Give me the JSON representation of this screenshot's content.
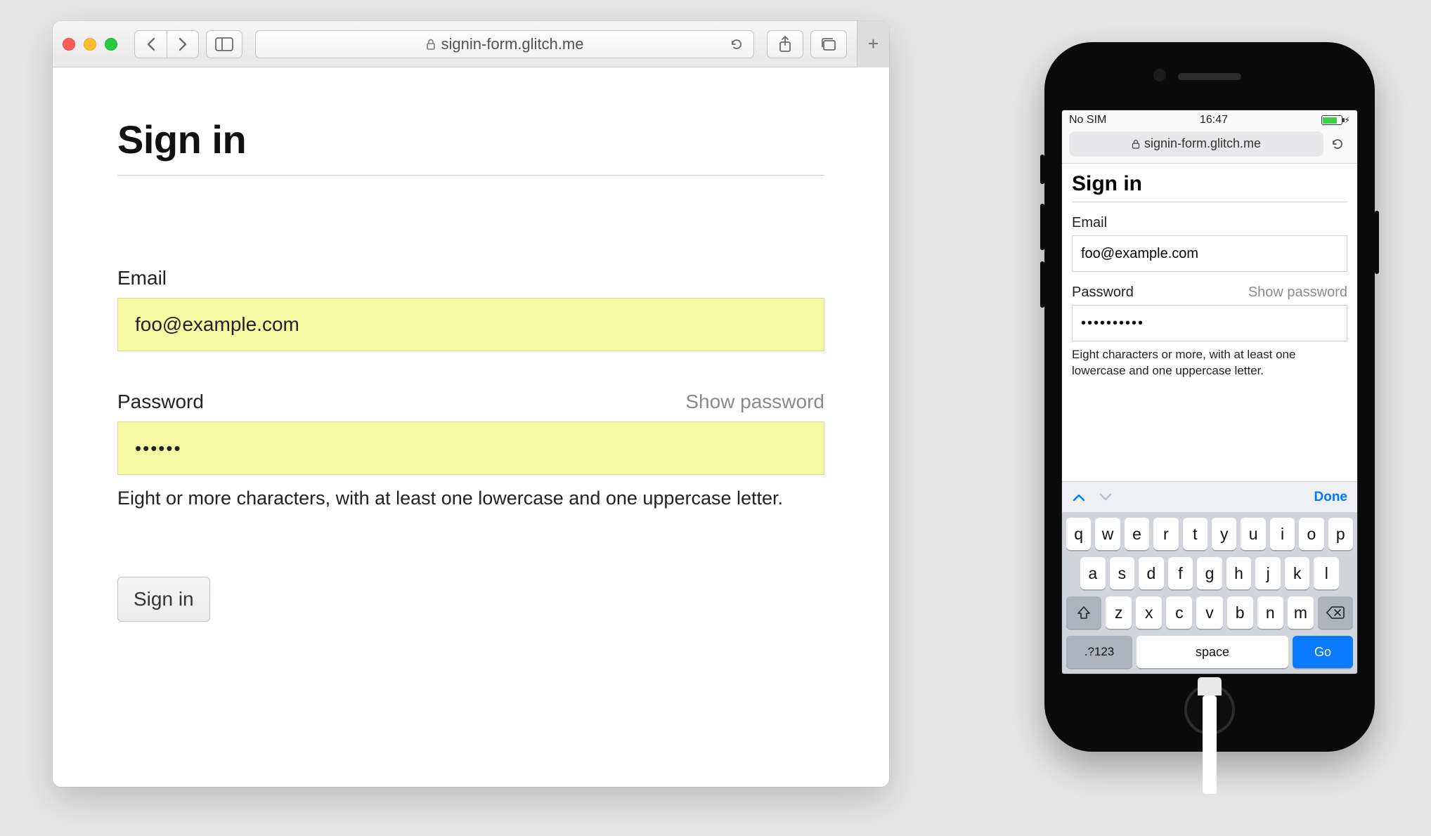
{
  "desktop": {
    "url_host": "signin-form.glitch.me",
    "form": {
      "title": "Sign in",
      "email_label": "Email",
      "email_value": "foo@example.com",
      "password_label": "Password",
      "show_password_label": "Show password",
      "password_masked": "••••••",
      "hint": "Eight or more characters, with at least one lowercase and one uppercase letter.",
      "submit_label": "Sign in"
    }
  },
  "mobile": {
    "status": {
      "carrier": "No SIM",
      "time": "16:47"
    },
    "url_host": "signin-form.glitch.me",
    "form": {
      "title": "Sign in",
      "email_label": "Email",
      "email_value": "foo@example.com",
      "password_label": "Password",
      "show_password_label": "Show password",
      "password_masked": "••••••••••",
      "hint": "Eight characters or more, with at least one lowercase and one uppercase letter."
    },
    "keyboard": {
      "done_label": "Done",
      "row1": [
        "q",
        "w",
        "e",
        "r",
        "t",
        "y",
        "u",
        "i",
        "o",
        "p"
      ],
      "row2": [
        "a",
        "s",
        "d",
        "f",
        "g",
        "h",
        "j",
        "k",
        "l"
      ],
      "row3": [
        "z",
        "x",
        "c",
        "v",
        "b",
        "n",
        "m"
      ],
      "numswitch": ".?123",
      "space": "space",
      "go": "Go"
    }
  }
}
